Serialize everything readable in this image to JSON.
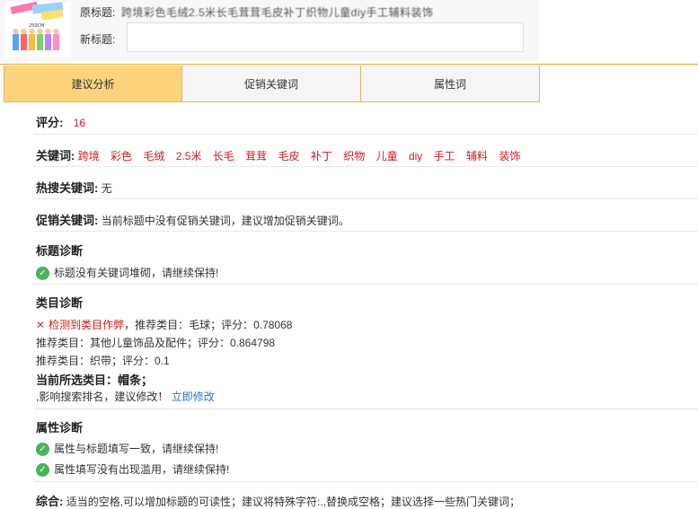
{
  "header": {
    "thumb_label": "product-image",
    "orig_label": "原标题:",
    "orig_value": "跨境彩色毛绒2.5米长毛茸茸毛皮补丁织物儿童diy手工辅料装饰",
    "new_label": "新标题:",
    "new_value": ""
  },
  "tabs": [
    {
      "label": "建议分析",
      "active": true
    },
    {
      "label": "促销关键词",
      "active": false
    },
    {
      "label": "属性词",
      "active": false
    }
  ],
  "score": {
    "label": "评分:",
    "value": "16"
  },
  "keywords": {
    "label": "关键词:",
    "items": [
      "跨境",
      "彩色",
      "毛绒",
      "2.5米",
      "长毛",
      "茸茸",
      "毛皮",
      "补丁",
      "织物",
      "儿童",
      "diy",
      "手工",
      "辅料",
      "装饰"
    ]
  },
  "hot": {
    "label": "热搜关键词:",
    "value": "无"
  },
  "promo": {
    "label": "促销关键词:",
    "value": "当前标题中没有促销关键词，建议增加促销关键词。"
  },
  "title_diag": {
    "heading": "标题诊断",
    "ok_text": "标题没有关键词堆砌，请继续保持!"
  },
  "cat_diag": {
    "heading": "类目诊断",
    "alert": "检测到类目作弊",
    "line1": "，推荐类目：毛球；评分：0.78068",
    "line2": "推荐类目：其他儿童饰品及配件；评分：0.864798",
    "line3": "推荐类目：织带；评分：0.1",
    "current_label": "当前所选类目：",
    "current_value": "帽条；",
    "impact": ",影响搜索排名，建议修改！",
    "fix_link": "立即修改"
  },
  "attr_diag": {
    "heading": "属性诊断",
    "ok1": "属性与标题填写一致，请继续保持!",
    "ok2": "属性填写没有出现滥用，请继续保持!"
  },
  "summary": {
    "label": "综合:",
    "text": "适当的空格,可以增加标题的可读性；建议将特殊字符:.,替换成空格；建议选择一些热门关键词；"
  },
  "colors": {
    "accent": "#fdd37b",
    "alert": "#d21919",
    "ok": "#49b35a",
    "link": "#2a74c9"
  }
}
